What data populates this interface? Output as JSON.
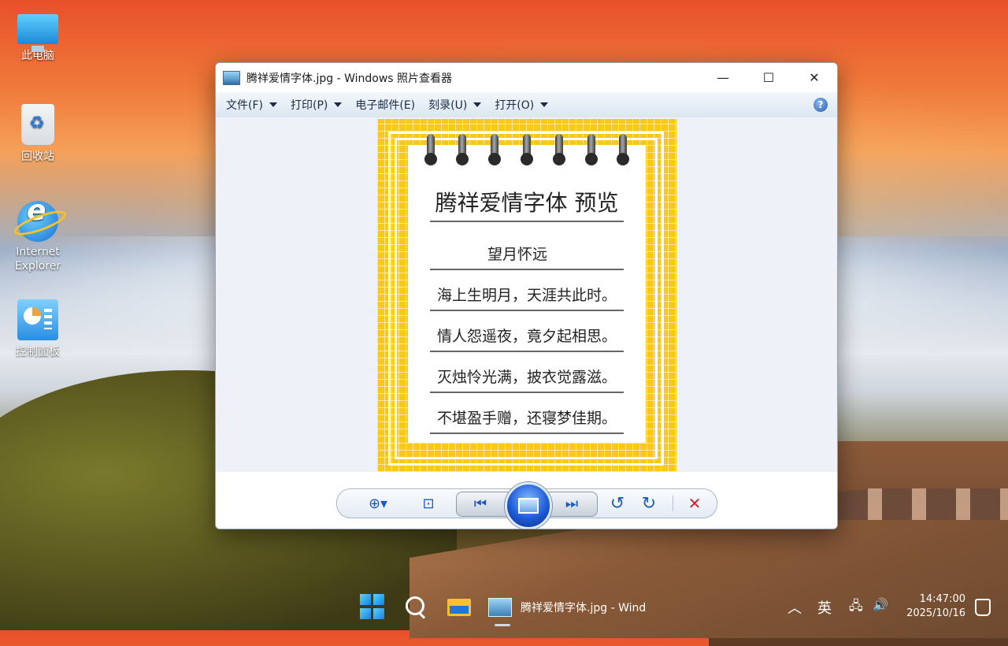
{
  "desktop": {
    "icons": [
      {
        "label": "此电脑"
      },
      {
        "label": "回收站"
      },
      {
        "label": "Internet\nExplorer"
      },
      {
        "label": "控制面板"
      }
    ]
  },
  "window": {
    "title": "腾祥爱情字体.jpg - Windows 照片查看器",
    "controls": {
      "minimize": "—",
      "maximize": "☐",
      "close": "✕"
    },
    "menu": [
      {
        "label": "文件(F)"
      },
      {
        "label": "打印(P)"
      },
      {
        "label": "电子邮件(E)"
      },
      {
        "label": "刻录(U)"
      },
      {
        "label": "打开(O)"
      }
    ],
    "help": "?"
  },
  "photo": {
    "title": "腾祥爱情字体  预览",
    "subtitle": "望月怀远",
    "lines": [
      "海上生明月，天涯共此时。",
      "情人怨遥夜，竟夕起相思。",
      "灭烛怜光满，披衣觉露滋。",
      "不堪盈手赠，还寝梦佳期。"
    ]
  },
  "toolbar": {
    "zoom": "⊕▾",
    "fit": "⊡",
    "prev": "⏮",
    "next": "⏭",
    "rotate_ccw": "↺",
    "rotate_cw": "↻",
    "delete": "✕"
  },
  "taskbar": {
    "app_label": "腾祥爱情字体.jpg - Wind",
    "tray_chevron": "︿",
    "ime": "英",
    "time": "14:47:00",
    "date": "2025/10/16"
  },
  "colors": {
    "photo_yellow": "#fbc818",
    "toolbar_blue": "#1f5ac0",
    "delete_red": "#d0242a"
  }
}
